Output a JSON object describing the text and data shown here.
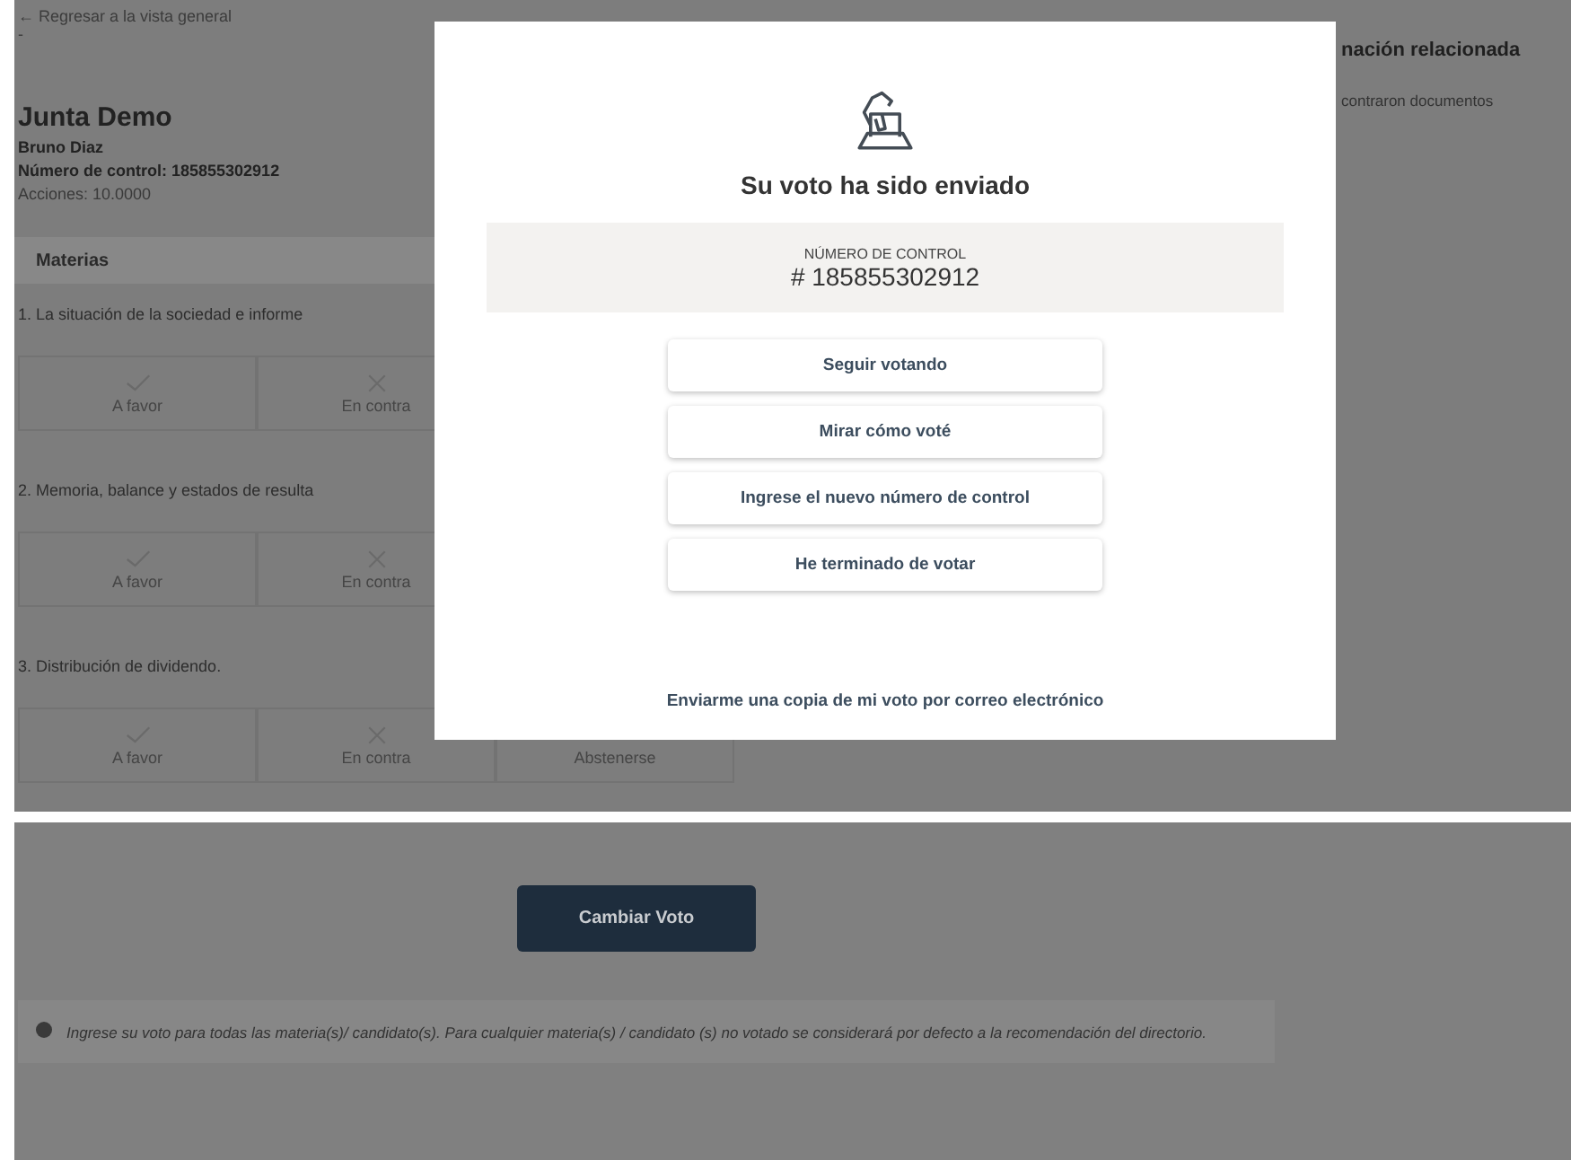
{
  "page": {
    "back_link": "← Regresar a la vista general",
    "back_note": "-",
    "title": "Junta Demo",
    "holder": "Bruno Diaz",
    "control_number": "Número de control: 185855302912",
    "shares": "Acciones: 10.0000"
  },
  "materias": {
    "heading": "Materias",
    "items": [
      {
        "text": "1. La situación de la sociedad e informe",
        "options": [
          {
            "kind": "for",
            "label": "A favor"
          },
          {
            "kind": "against",
            "label": "En contra"
          }
        ]
      },
      {
        "text": "2. Memoria, balance y estados de resulta",
        "options": [
          {
            "kind": "for",
            "label": "A favor"
          },
          {
            "kind": "against",
            "label": "En contra"
          }
        ]
      },
      {
        "text": "3. Distribución de dividendo.",
        "options": [
          {
            "kind": "for",
            "label": "A favor"
          },
          {
            "kind": "against",
            "label": "En contra"
          },
          {
            "kind": "abstain",
            "label": "Abstenerse"
          }
        ]
      }
    ]
  },
  "related": {
    "heading": "nación relacionada",
    "note": "contraron documentos"
  },
  "modal": {
    "title": "Su voto ha sido enviado",
    "control_label": "NÚMERO DE CONTROL",
    "control_number": "# 185855302912",
    "actions": [
      "Seguir votando",
      "Mirar cómo voté",
      "Ingrese el nuevo número de control",
      "He terminado de votar"
    ],
    "email_link": "Enviarme una copia de mi voto por correo electrónico"
  },
  "footer": {
    "button": "Cambiar Voto",
    "notice": "Ingrese su voto para todas las materia(s)/ candidato(s). Para cualquier materia(s) / candidato (s) no votado se considerará por defecto a la recomendación del directorio."
  }
}
